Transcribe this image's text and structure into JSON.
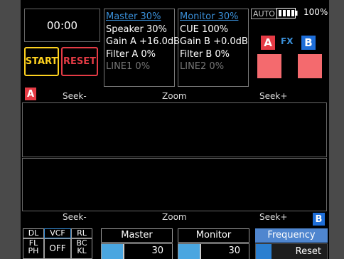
{
  "time": "00:00",
  "buttons": {
    "start": "START",
    "reset": "RESET"
  },
  "master_panel": {
    "title": "Master 30%",
    "lines": [
      "Speaker 30%",
      "Gain A +16.0dB",
      "Filter A 0%",
      "LINE1 0%"
    ]
  },
  "monitor_panel": {
    "title": "Monitor 30%",
    "lines": [
      "CUE 100%",
      "Gain B +0.0dB",
      "Filter B 0%",
      "LINE2 0%"
    ]
  },
  "status": {
    "auto": "AUTO",
    "battery": "100%",
    "battery_level": 1.0
  },
  "fx": {
    "a": "A",
    "label": "FX",
    "b": "B"
  },
  "deck_a": {
    "badge": "A",
    "seek_minus": "Seek-",
    "zoom": "Zoom",
    "seek_plus": "Seek+"
  },
  "deck_b": {
    "badge": "B",
    "seek_minus": "Seek-",
    "zoom": "Zoom",
    "seek_plus": "Seek+"
  },
  "filter_grid": {
    "dl": "DL",
    "vcf": "VCF",
    "rl": "RL",
    "fl": "FL",
    "ph": "PH",
    "off": "OFF",
    "bc": "BC",
    "kl": "KL"
  },
  "master_slider": {
    "label": "Master",
    "value": "30",
    "level": 0.3
  },
  "monitor_slider": {
    "label": "Monitor",
    "value": "30",
    "level": 0.3
  },
  "frequency": {
    "label": "Frequency",
    "reset": "Reset"
  },
  "colors": {
    "accent_blue": "#3a8fd8",
    "red": "#e53b45",
    "yellow": "#ffd21f",
    "pad": "#f46a6e"
  }
}
